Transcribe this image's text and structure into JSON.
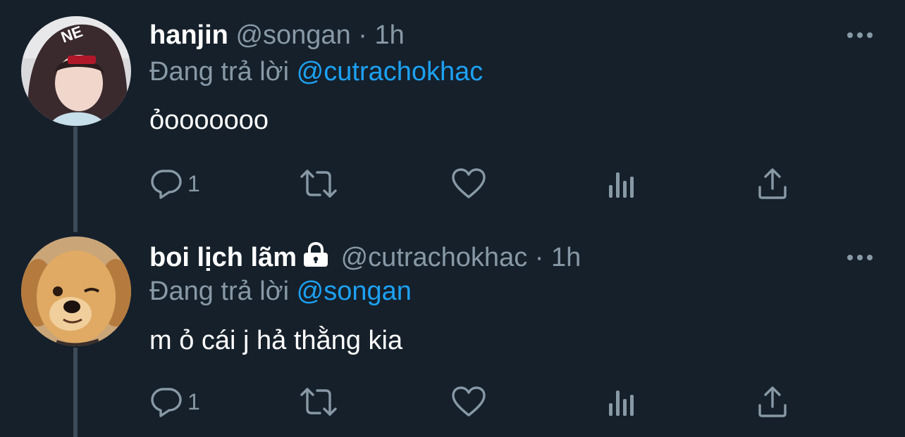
{
  "tweets": [
    {
      "name": "hanjin",
      "handle": "@songan",
      "separator": "·",
      "time": "1h",
      "reply_prefix": "Đang trả lời",
      "reply_mention": "@cutrachokhac",
      "text": "ỏooooooo",
      "reply_count": "1",
      "locked": false,
      "avatar": "person-in-hood-photo"
    },
    {
      "name": "boi lịch lãm",
      "handle": "@cutrachokhac",
      "separator": "·",
      "time": "1h",
      "reply_prefix": "Đang trả lời",
      "reply_mention": "@songan",
      "text": "m ỏ cái j hả thằng kia",
      "reply_count": "1",
      "locked": true,
      "avatar": "golden-retriever-winking-photo"
    }
  ],
  "icons": {
    "reply": "reply-icon",
    "retweet": "retweet-icon",
    "like": "like-icon",
    "analytics": "analytics-icon",
    "share": "share-icon",
    "more": "more-icon",
    "lock": "lock-icon"
  },
  "colors": {
    "background": "#15202b",
    "text": "#ffffff",
    "muted": "#8899a6",
    "link": "#1da1f2",
    "thread_line": "#3d4a57"
  }
}
